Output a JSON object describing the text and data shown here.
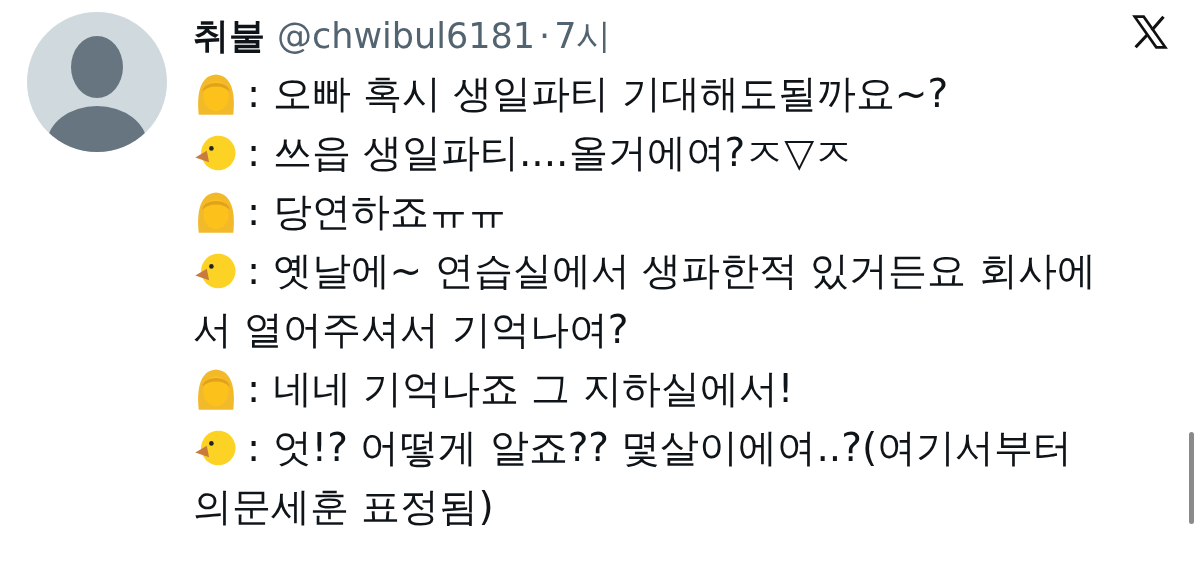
{
  "author": {
    "name": "취불",
    "handle": "@chwibul6181",
    "separator": "·",
    "time": "7시"
  },
  "lines": [
    {
      "kind": "woman",
      "text": ": 오빠 혹시 생일파티 기대해도될까요~?"
    },
    {
      "kind": "chick",
      "text": ": 쓰읍 생일파티....올거에여?ㅈ▽ㅈ"
    },
    {
      "kind": "woman",
      "text": ": 당연하죠ㅠㅠ"
    },
    {
      "kind": "chick",
      "text": ": 옛날에~ 연습실에서 생파한적 있거든요 회사에",
      "continuation": "서 열어주셔서 기억나여?"
    },
    {
      "kind": "woman",
      "text": ": 네네 기억나죠 그 지하실에서!"
    },
    {
      "kind": "chick",
      "text": ": 엇!? 어떻게 알죠?? 몇살이에여..?(여기서부터",
      "continuation": "의문세훈 표정됨)"
    }
  ]
}
